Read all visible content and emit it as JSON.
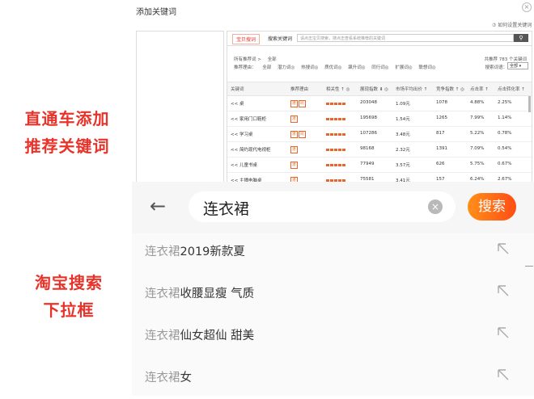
{
  "captions": {
    "top_line1": "直通车添加",
    "top_line2": "推荐关键词",
    "bottom_line1": "淘宝搜索",
    "bottom_line2": "下拉框"
  },
  "panel": {
    "title": "添加关键词",
    "help": "⑦ 如何设置关键词",
    "tabs": [
      "宝贝搜词",
      "搜索关键词"
    ],
    "search_placeholder": "请点击宝贝搜索，搜点击查看系统推荐的关键词",
    "filters": {
      "row1_label": "所有推荐词 >",
      "row1_value": "全部",
      "row2_label": "推荐理由：",
      "row2_items": [
        "全部",
        "潜力词◎",
        "热搜词◎",
        "质优词◎",
        "飙升词◎",
        "同行词◎",
        "扩展词◎",
        "联想词◎"
      ]
    },
    "total": "共推荐 783 个关键词",
    "sort_label": "搜索词语：",
    "sort_value": "全部",
    "columns": [
      "关键词",
      "推荐理由",
      "相关性 ↑ ◎",
      "展现指数 ⬇ ◎",
      "市场平均出价 ↑",
      "竞争指数 ↑ ◎",
      "点击率 ↑",
      "点击转化率 ↑"
    ],
    "rows": [
      {
        "keyword": "<< 桌",
        "tags": [
          "潜",
          "同"
        ],
        "impressions": "203048",
        "avg_bid": "1.09元",
        "competition": "1078",
        "ctr": "4.88%",
        "cvr": "2.25%"
      },
      {
        "keyword": "<< 家用门口鞋柜",
        "tags": [
          "潜"
        ],
        "impressions": "195698",
        "avg_bid": "1.54元",
        "competition": "1265",
        "ctr": "7.99%",
        "cvr": "1.14%"
      },
      {
        "keyword": "<< 学习桌",
        "tags": [
          "潜",
          "同"
        ],
        "impressions": "107286",
        "avg_bid": "3.48元",
        "competition": "817",
        "ctr": "5.22%",
        "cvr": "0.78%"
      },
      {
        "keyword": "<< 简约现代电视柜",
        "tags": [
          "潜"
        ],
        "impressions": "98168",
        "avg_bid": "2.32元",
        "competition": "1391",
        "ctr": "7.09%",
        "cvr": "0.54%"
      },
      {
        "keyword": "<< 儿童书桌",
        "tags": [
          "潜"
        ],
        "impressions": "77949",
        "avg_bid": "3.57元",
        "competition": "626",
        "ctr": "5.75%",
        "cvr": "0.67%"
      },
      {
        "keyword": "<< 主播电脑桌",
        "tags": [
          "潜"
        ],
        "impressions": "75581",
        "avg_bid": "3.41元",
        "competition": "157",
        "ctr": "6.24%",
        "cvr": "2.67%"
      }
    ]
  },
  "mobile_search": {
    "query": "连衣裙",
    "button": "搜索",
    "suggestions": [
      {
        "kw": "连衣裙",
        "rest": "2019新款夏"
      },
      {
        "kw": "连衣裙",
        "rest": "收腰显瘦 气质"
      },
      {
        "kw": "连衣裙",
        "rest": "仙女超仙 甜美"
      },
      {
        "kw": "连衣裙",
        "rest": "女"
      }
    ]
  },
  "colors": {
    "caption_red": "#e8332a",
    "accent_orange": "#ff6a00"
  }
}
